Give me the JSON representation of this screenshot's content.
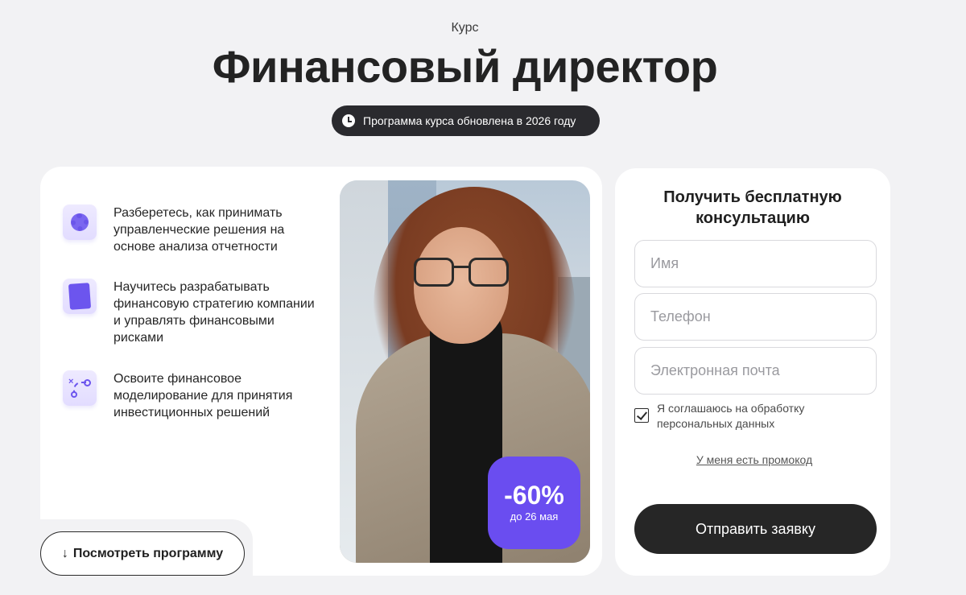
{
  "header": {
    "eyebrow": "Курс",
    "title": "Финансовый директор",
    "update_note": "Программа курса обновлена в 2026 году",
    "update_icon": "clock-icon"
  },
  "features": [
    {
      "icon": "gear-icon",
      "text": "Разберетесь, как принимать управленческие решения на основе анализа отчетности"
    },
    {
      "icon": "tablet-icon",
      "text": "Научитесь разрабатывать финансовую стратегию компании и управлять финансовыми рисками"
    },
    {
      "icon": "route-icon",
      "text": "Освоите финансовое моделирование для принятия инвестиционных решений"
    }
  ],
  "promo_badge": {
    "discount": "-60%",
    "until": "до 26 мая",
    "color": "#6a4df0"
  },
  "program_button": {
    "label": "Посмотреть программу",
    "icon": "arrow-down-icon"
  },
  "form": {
    "title": "Получить бесплатную консультацию",
    "name_placeholder": "Имя",
    "phone_placeholder": "Телефон",
    "email_placeholder": "Электронная почта",
    "consent_label": "Я соглашаюсь на обработку персональных данных",
    "consent_checked": true,
    "promo_link": "У меня есть промокод",
    "submit_label": "Отправить заявку"
  },
  "colors": {
    "background": "#f2f2f4",
    "accent": "#6a4df0",
    "dark": "#262626"
  }
}
